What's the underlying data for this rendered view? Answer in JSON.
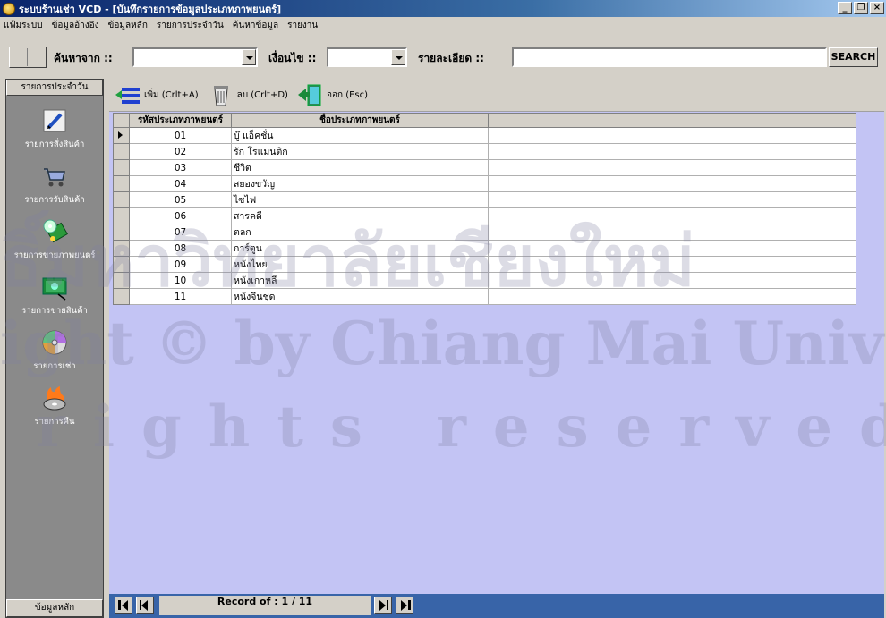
{
  "window": {
    "title": "ระบบร้านเช่า VCD - [บันทึกรายการข้อมูลประเภทภาพยนตร์]",
    "controls": [
      "_",
      "❐",
      "×"
    ]
  },
  "menu": [
    "แฟ้มระบบ",
    "ข้อมูลอ้างอิง",
    "ข้อมูลหลัก",
    "รายการประจำวัน",
    "ค้นหาข้อมูล",
    "รายงาน"
  ],
  "search": {
    "from_label": "ค้นหาจาก ::",
    "condition_label": "เงื่อนไข ::",
    "detail_label": "รายละเอียด ::",
    "from_value": "",
    "condition_value": "",
    "detail_value": "",
    "button": "SEARCH"
  },
  "sidebar": {
    "header": "รายการประจำวัน",
    "footer": "ข้อมูลหลัก",
    "items": [
      {
        "label": "รายการสั่งสินค้า",
        "icon": "pencil-icon"
      },
      {
        "label": "รายการรับสินค้า",
        "icon": "cart-icon"
      },
      {
        "label": "รายการขายภาพยนตร์",
        "icon": "disc-money-icon"
      },
      {
        "label": "รายการขายสินค้า",
        "icon": "money-icon"
      },
      {
        "label": "รายการเช่า",
        "icon": "cd-icon"
      },
      {
        "label": "รายการคืน",
        "icon": "fire-disc-icon"
      }
    ]
  },
  "toolbar": {
    "add": "เพิ่ม (Crlt+A)",
    "delete": "ลบ (Crlt+D)",
    "exit": "ออก (Esc)"
  },
  "table": {
    "columns": [
      "รหัสประเภทภาพยนตร์",
      "ชื่อประเภทภาพยนตร์"
    ],
    "rows": [
      [
        "01",
        "บู๊ แอ็คชั่น"
      ],
      [
        "02",
        "รัก โรแมนติก"
      ],
      [
        "03",
        "ชีวิต"
      ],
      [
        "04",
        "สยองขวัญ"
      ],
      [
        "05",
        "ไซไฟ"
      ],
      [
        "06",
        "สารคดี"
      ],
      [
        "07",
        "ตลก"
      ],
      [
        "08",
        "การ์ตูน"
      ],
      [
        "09",
        "หนังไทย"
      ],
      [
        "10",
        "หนังเกาหลี"
      ],
      [
        "11",
        "หนังจีนชุด"
      ]
    ]
  },
  "navigator": {
    "record_text": "Record of  :  1 / 11"
  },
  "colors": {
    "titlebar": "#0a246a",
    "main_bg": "#c3c4f4",
    "navbar": "#3864a8",
    "sidebar": "#8a8a8a"
  }
}
